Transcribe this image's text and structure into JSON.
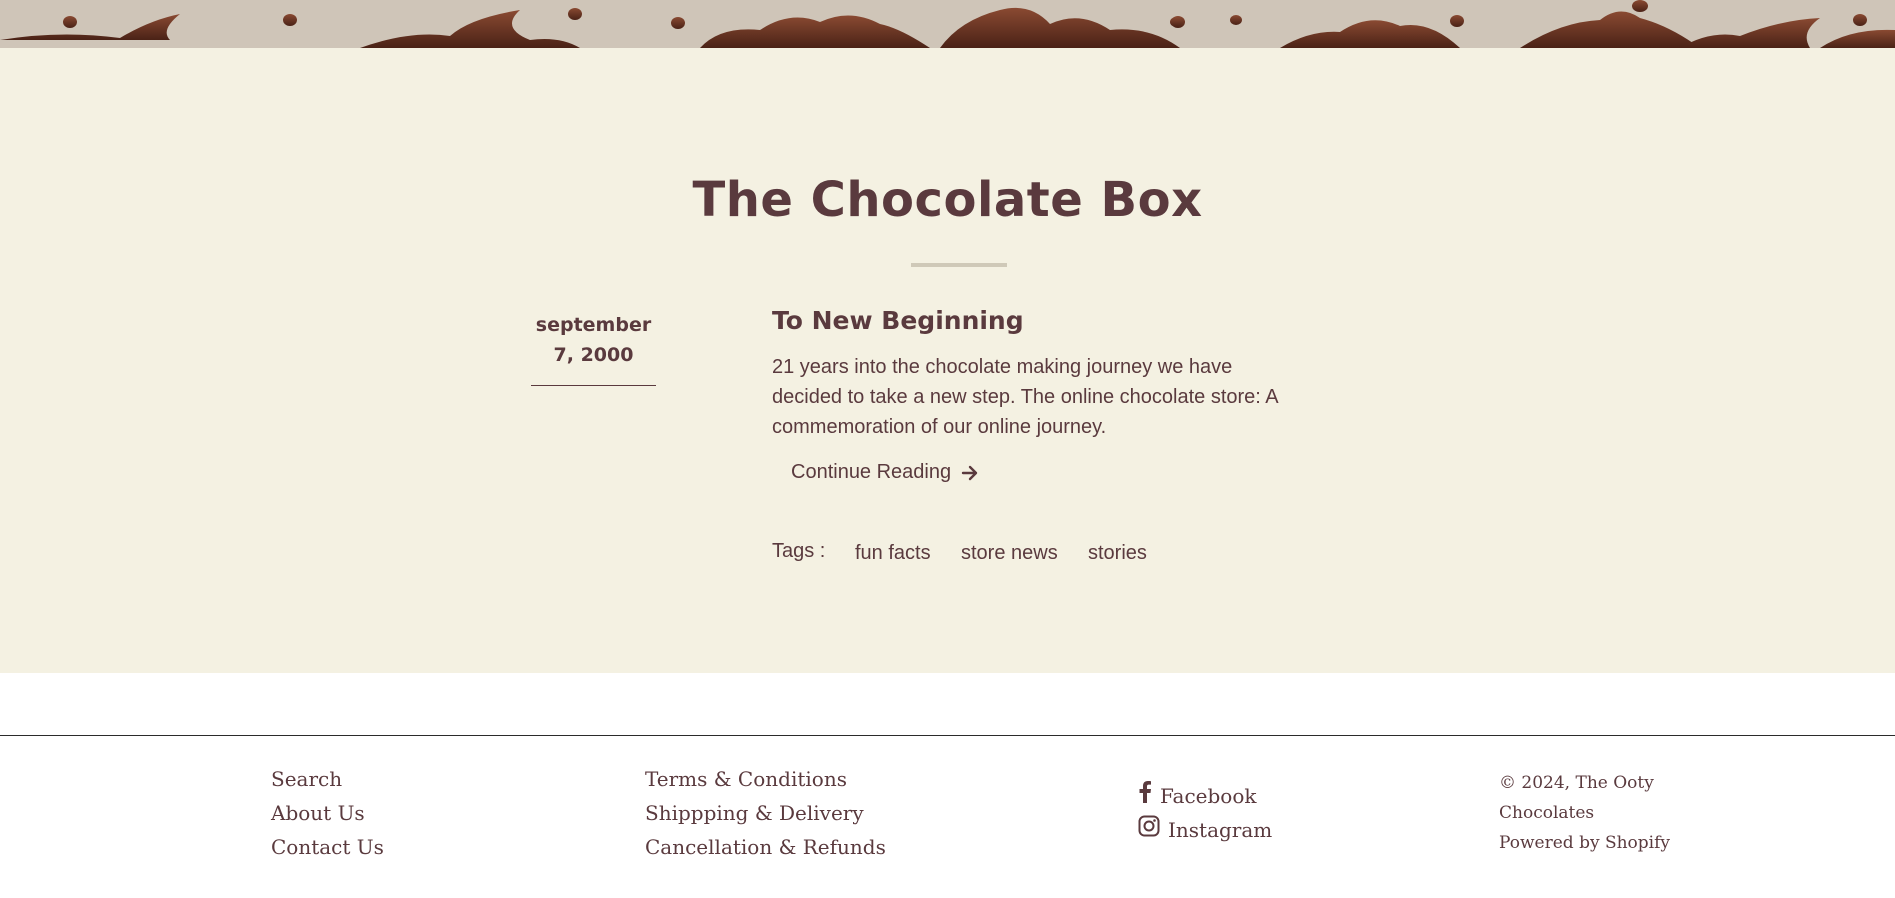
{
  "blog": {
    "title": "The Chocolate Box"
  },
  "article": {
    "date": "september 7, 2000",
    "title": "To New Beginning",
    "excerpt": "21 years into the chocolate making journey we have decided to take a new step. The online chocolate store: A commemoration of our online journey.",
    "continue_label": "Continue Reading",
    "tags_label": "Tags :",
    "tags": [
      "fun facts",
      "store news",
      "stories"
    ]
  },
  "footer": {
    "col1": [
      "Search",
      "About Us",
      "Contact Us"
    ],
    "col2": [
      "Terms & Conditions",
      "Shippping & Delivery",
      "Cancellation & Refunds"
    ],
    "social": [
      {
        "label": "Facebook",
        "icon": "facebook-icon"
      },
      {
        "label": "Instagram",
        "icon": "instagram-icon"
      }
    ],
    "copyright_line1": "© 2024, The Ooty",
    "copyright_line2": "Chocolates",
    "powered_by": "Powered by Shopify"
  },
  "colors": {
    "brand_text": "#5a3a3e",
    "page_background": "#f4f1e2",
    "banner_background": "#cfc5b8",
    "chocolate": "#5c2e1f"
  }
}
